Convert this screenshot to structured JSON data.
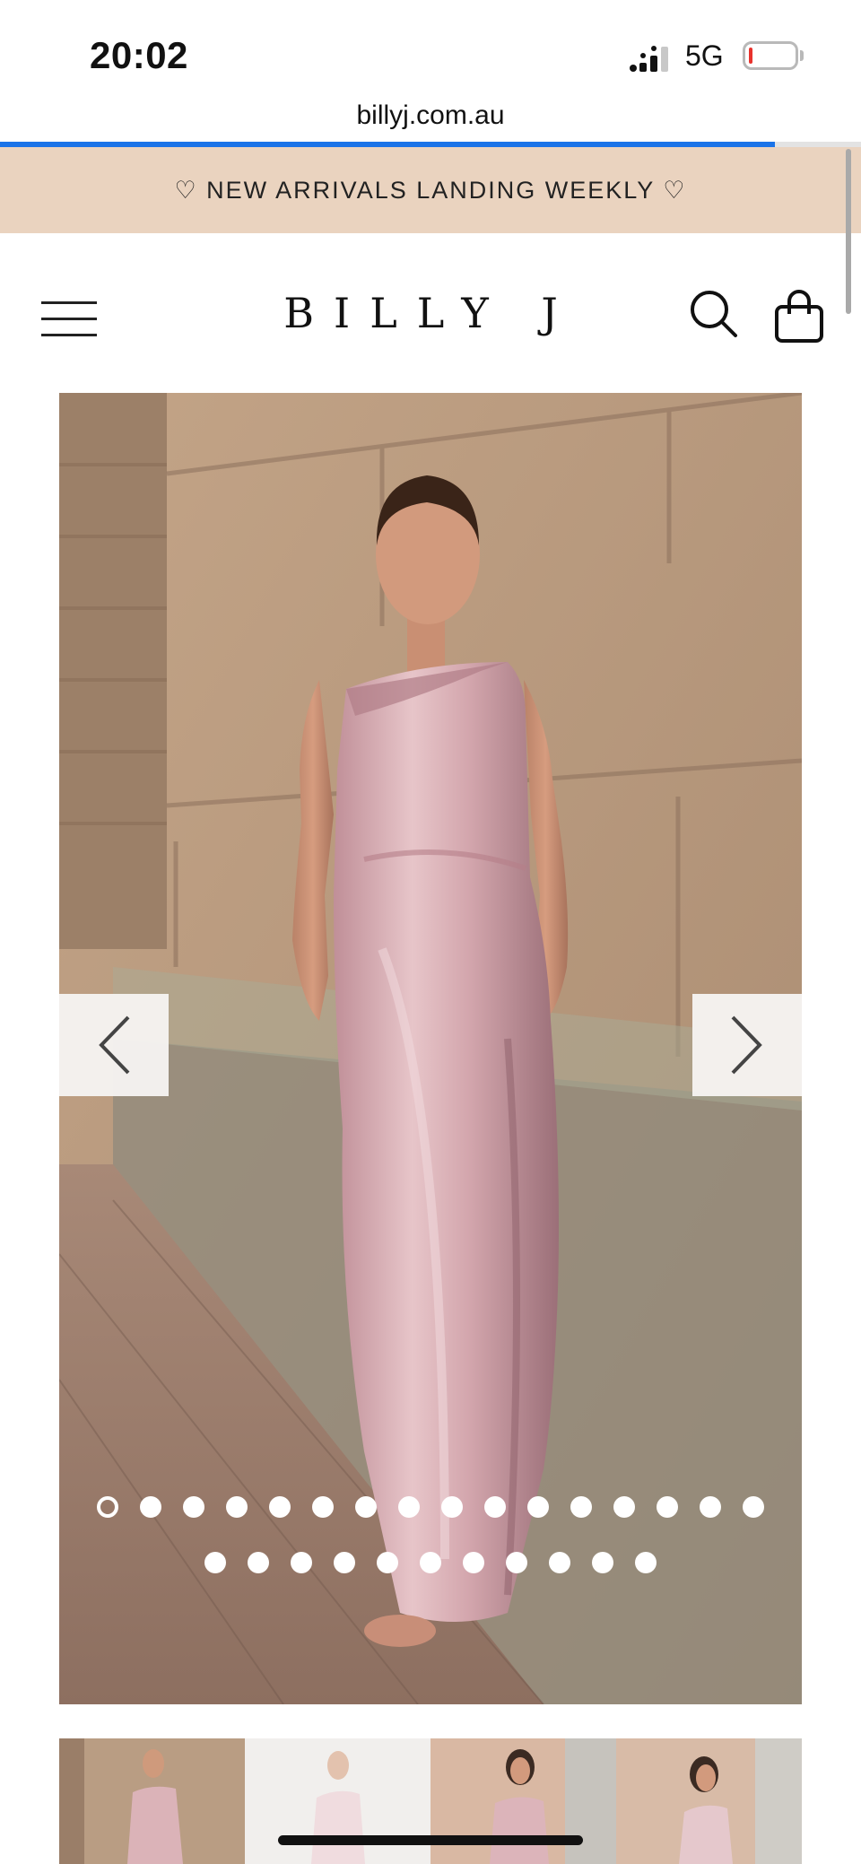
{
  "status_bar": {
    "time": "20:02",
    "network": "5G",
    "battery_level": 0.05
  },
  "browser": {
    "url": "billyj.com.au",
    "load_progress": 0.9
  },
  "promo_banner": {
    "text": "♡ NEW ARRIVALS LANDING WEEKLY ♡"
  },
  "header": {
    "logo": "BILLY J"
  },
  "gallery": {
    "total_images": 27,
    "active_index": 0,
    "dots_row1": 16,
    "dots_row2": 11,
    "thumbnail_count": 4
  },
  "colors": {
    "promo_bg": "#ead3bf",
    "progress": "#1a73e8",
    "dress": "#d8aeb3"
  }
}
